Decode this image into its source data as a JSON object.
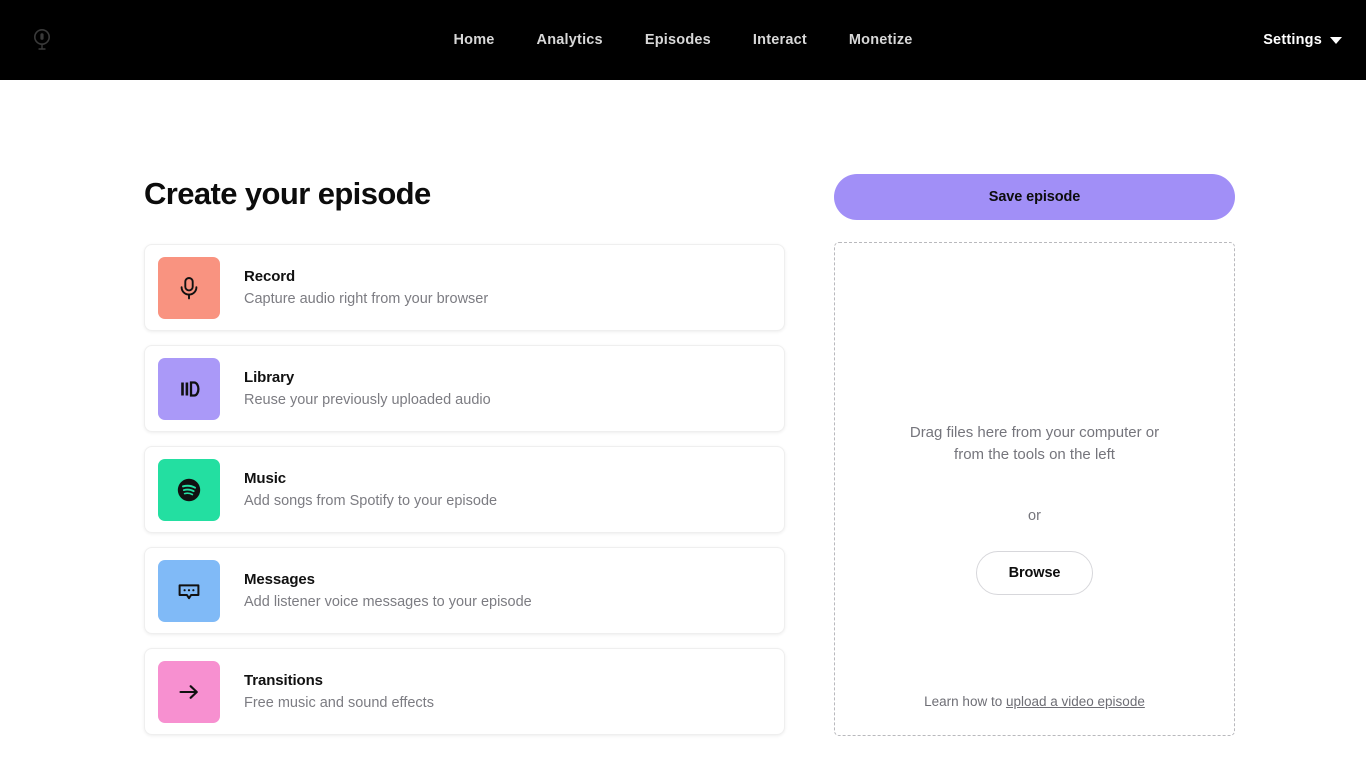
{
  "nav": {
    "logo_icon": "anchor-podcast-mic-logo",
    "links": [
      {
        "label": "Home"
      },
      {
        "label": "Analytics"
      },
      {
        "label": "Episodes"
      },
      {
        "label": "Interact"
      },
      {
        "label": "Monetize"
      }
    ],
    "settings_label": "Settings",
    "settings_caret_icon": "chevron-down-icon",
    "background": "#000000",
    "link_color": "#d8d8d8"
  },
  "main": {
    "title": "Create your episode",
    "tools": [
      {
        "title": "Record",
        "subtitle": "Capture audio right from your browser",
        "icon": "microphone-icon",
        "color": "#f99380"
      },
      {
        "title": "Library",
        "subtitle": "Reuse your previously uploaded audio",
        "icon": "library-books-icon",
        "color": "#aa99f8"
      },
      {
        "title": "Music",
        "subtitle": "Add songs from Spotify to your episode",
        "icon": "spotify-icon",
        "color": "#23dfa1"
      },
      {
        "title": "Messages",
        "subtitle": "Add listener voice messages to your episode",
        "icon": "speech-bubble-icon",
        "color": "#80baf7"
      },
      {
        "title": "Transitions",
        "subtitle": "Free music and sound effects",
        "icon": "arrow-right-icon",
        "color": "#f790d0"
      }
    ]
  },
  "sidebar": {
    "save_label": "Save episode",
    "save_color": "#a18ff7",
    "dropzone": {
      "line1": "Drag files here from your computer or",
      "line2": "from the tools on the left",
      "or": "or",
      "browse_label": "Browse",
      "footer_prefix": "Learn how to ",
      "footer_link": "upload a video episode"
    }
  }
}
